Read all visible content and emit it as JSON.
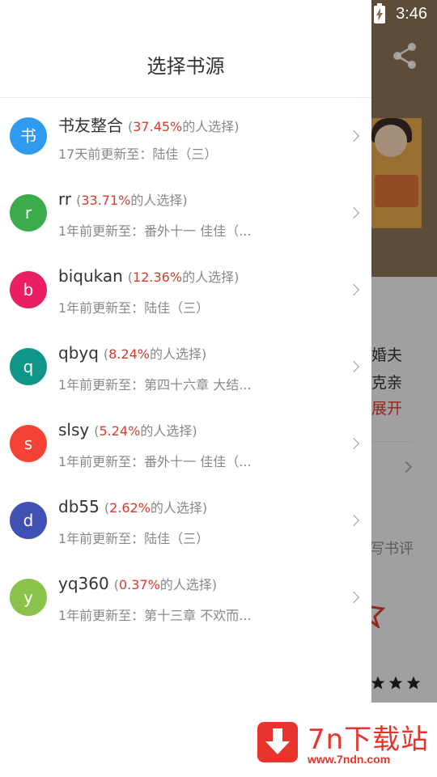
{
  "status_bar": {
    "time": "3:46"
  },
  "drawer": {
    "title": "选择书源",
    "sources": [
      {
        "avatar": "书",
        "color": "#2f9bf0",
        "name": "书友整合",
        "percent": "37.45%",
        "percent_suffix": "的人选择)",
        "update": "17天前更新至：陆佳（三）"
      },
      {
        "avatar": "r",
        "color": "#3cab4c",
        "name": "rr",
        "percent": "33.71%",
        "percent_suffix": "的人选择)",
        "update": "1年前更新至：番外十一 佳佳（..."
      },
      {
        "avatar": "b",
        "color": "#e91e63",
        "name": "biqukan",
        "percent": "12.36%",
        "percent_suffix": "的人选择)",
        "update": "1年前更新至：陆佳（三）"
      },
      {
        "avatar": "q",
        "color": "#0f9688",
        "name": "qbyq",
        "percent": "8.24%",
        "percent_suffix": "的人选择)",
        "update": "1年前更新至：第四十六章 大结..."
      },
      {
        "avatar": "s",
        "color": "#f44336",
        "name": "slsy",
        "percent": "5.24%",
        "percent_suffix": "的人选择)",
        "update": "1年前更新至：番外十一 佳佳（..."
      },
      {
        "avatar": "d",
        "color": "#3f51b5",
        "name": "db55",
        "percent": "2.62%",
        "percent_suffix": "的人选择)",
        "update": "1年前更新至：陆佳（三）"
      },
      {
        "avatar": "y",
        "color": "#8bc34a",
        "name": "yq360",
        "percent": "0.37%",
        "percent_suffix": "的人选择)",
        "update": "1年前更新至：第十三章 不欢而..."
      }
    ]
  },
  "background_page": {
    "line1": "婚夫",
    "line2": "克亲",
    "expand": "展开",
    "write_review": "写书评",
    "partial_digit": ")"
  },
  "watermark": {
    "brand": "7n下载站",
    "url": "www.7ndn.com"
  }
}
